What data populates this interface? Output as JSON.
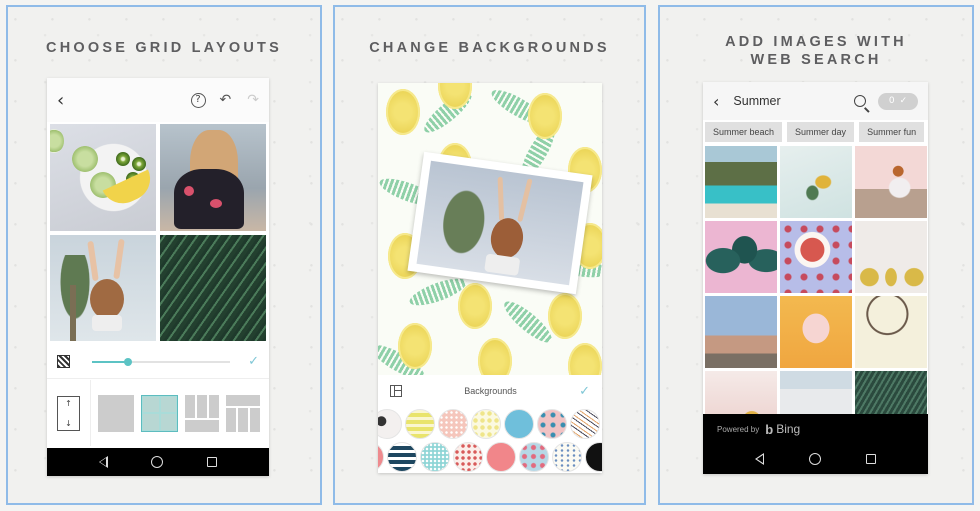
{
  "panels": [
    {
      "title": "CHOOSE GRID LAYOUTS"
    },
    {
      "title": "CHANGE BACKGROUNDS"
    },
    {
      "title_line1": "ADD IMAGES WITH",
      "title_line2": "WEB SEARCH"
    }
  ],
  "grid_editor": {
    "toolbar": {
      "back_icon": "chevron-left",
      "help_label": "?",
      "undo_icon": "undo",
      "redo_icon": "redo"
    },
    "photos": [
      "smoothie-bowl-with-kiwi",
      "girl-with-sunglasses",
      "girl-arms-raised-palms",
      "fern-leaves"
    ],
    "spacing_slider": {
      "value": 0.26
    },
    "confirm_icon": "check",
    "layouts": [
      "single",
      "grid-2x2",
      "three-top-one-bottom",
      "one-top-three-bottom"
    ],
    "selected_layout": "grid-2x2",
    "swap_icon": "swap-vertical"
  },
  "backgrounds_editor": {
    "toolbar_title": "Backgrounds",
    "layout_icon": "layout",
    "confirm_icon": "check",
    "canvas_pattern": "pineapples-and-palm-leaves",
    "swatches_row1": [
      "locked-pattern",
      "yellow-stripes",
      "peach-dots",
      "lemon-pattern",
      "solid-blue",
      "floral-pink",
      "diagonal-stripes"
    ],
    "swatches_row2": [
      "pink-partial",
      "navy-stripes",
      "aqua-dots",
      "floral-red",
      "solid-pink",
      "floral-blue",
      "text-pattern",
      "solid-black"
    ]
  },
  "web_search": {
    "query": "Summer",
    "selected_count": "0",
    "suggestions": [
      "Summer beach",
      "Summer day",
      "Summer fun"
    ],
    "results": [
      "coast-waterfall",
      "pineapple-on-sand",
      "woman-on-rocks",
      "monstera-leaves-pink",
      "fruit-bowl",
      "three-pineapples",
      "palm-street",
      "ice-cream-cone",
      "dreamcatcher",
      "pineapple-pink",
      "white-buildings",
      "palm-fronds"
    ],
    "powered_by": "Powered by",
    "provider": "Bing"
  },
  "colors": {
    "accent": "#5cc3c4",
    "frame": "#8fbbe8",
    "title": "#5e5e60"
  }
}
